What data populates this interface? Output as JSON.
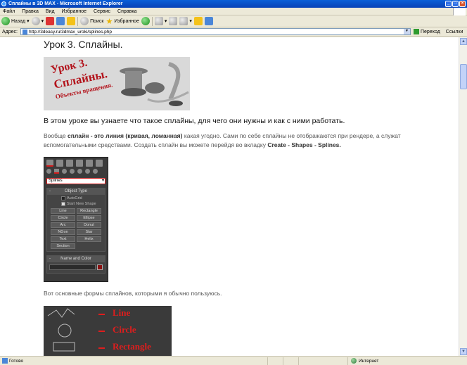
{
  "window": {
    "title": "Сплайны в 3D MAX - Microsoft Internet Explorer"
  },
  "menu": [
    "Файл",
    "Правка",
    "Вид",
    "Избранное",
    "Сервис",
    "Справка"
  ],
  "toolbar": {
    "back": "Назад",
    "search": "Поиск",
    "favorites": "Избранное"
  },
  "addressbar": {
    "label": "Адрес:",
    "url": "http://3deasy.ru/3dmax_uroki/splines.php",
    "go": "Переход",
    "links": "Ссылки"
  },
  "page": {
    "title": "Урок 3. Сплайны.",
    "banner": {
      "line1": "Урок 3.",
      "line2": "Сплайны.",
      "line3": "Объекты вращения."
    },
    "intro": "В этом уроке вы узнаете что такое сплайны, для чего они нужны и как с ними работать.",
    "para": {
      "p1": "Вообще ",
      "b1": "сплайн - это линия (кривая, ломанная)",
      "p2": " какая угодно. Сами по себе сплайны не отображаются при рендере, а служат вспомогательными средствами. Создать сплайн вы можете перейдя во вкладку ",
      "b2": "Create - Shapes - Splines."
    },
    "max_panel": {
      "dropdown": "Splines",
      "object_type": "Object Type",
      "autogrid": "AutoGrid",
      "start_new_shape": "Start New Shape",
      "buttons": [
        "Line",
        "Rectangle",
        "Circle",
        "Ellipse",
        "Arc",
        "Donut",
        "NGon",
        "Star",
        "Text",
        "Helix",
        "Section"
      ],
      "name_and_color": "Name and Color"
    },
    "para2": "Вот основные формы сплайнов, которыми я обычно пользуюсь.",
    "shapes": [
      "Line",
      "Circle",
      "Rectangle"
    ]
  },
  "status": {
    "text": "Готово",
    "zone": "Интернет"
  }
}
